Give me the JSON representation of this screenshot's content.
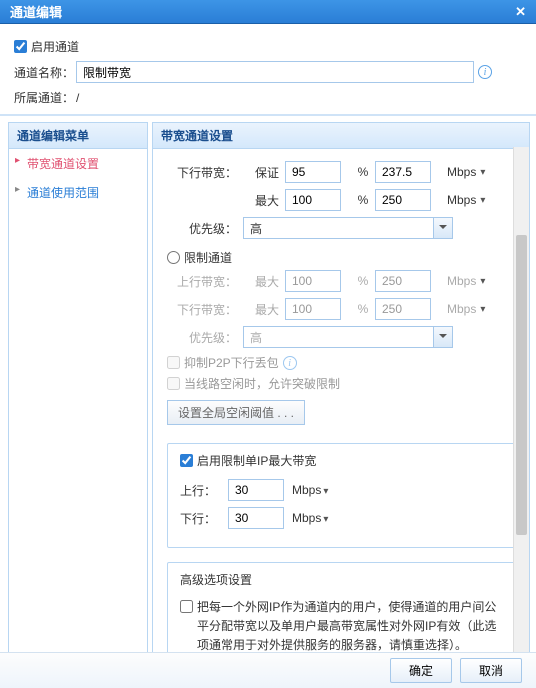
{
  "title": "通道编辑",
  "enable_channel_label": "启用通道",
  "enable_channel_checked": true,
  "channel_name_label": "通道名称：",
  "channel_name_value": "限制带宽",
  "parent_channel_label": "所属通道：",
  "parent_channel_value": "/",
  "sidebar": {
    "header": "通道编辑菜单",
    "items": [
      "带宽通道设置",
      "通道使用范围"
    ],
    "active_index": 0
  },
  "panel": {
    "header": "带宽通道设置",
    "down_label": "下行带宽：",
    "guarantee_label": "保证",
    "max_label": "最大",
    "down_guarantee_pct": "95",
    "down_guarantee_mbps": "237.5",
    "down_max_pct": "100",
    "down_max_mbps": "250",
    "priority_label": "优先级：",
    "priority_value": "高",
    "limit_radio_label": "限制通道",
    "up_label": "上行带宽：",
    "limit_up_pct": "100",
    "limit_up_mbps": "250",
    "limit_down_pct": "100",
    "limit_down_mbps": "250",
    "limit_priority_value": "高",
    "unit_label": "Mbps",
    "pct_label": "%",
    "suppress_p2p_label": "抑制P2P下行丢包",
    "allow_burst_label": "当线路空闲时，允许突破限制",
    "idle_button_label": "设置全局空闲阈值 . . .",
    "per_ip": {
      "title": "启用限制单IP最大带宽",
      "checked": true,
      "up_label": "上行：",
      "up_value": "30",
      "down_label": "下行：",
      "down_value": "30"
    },
    "advanced": {
      "title": "高级选项设置",
      "checkbox_text": "把每一个外网IP作为通道内的用户，使得通道的用户间公平分配带宽以及单用户最高带宽属性对外网IP有效（此选项通常用于对外提供服务的服务器，请慎重选择）。"
    }
  },
  "buttons": {
    "ok": "确定",
    "cancel": "取消"
  }
}
